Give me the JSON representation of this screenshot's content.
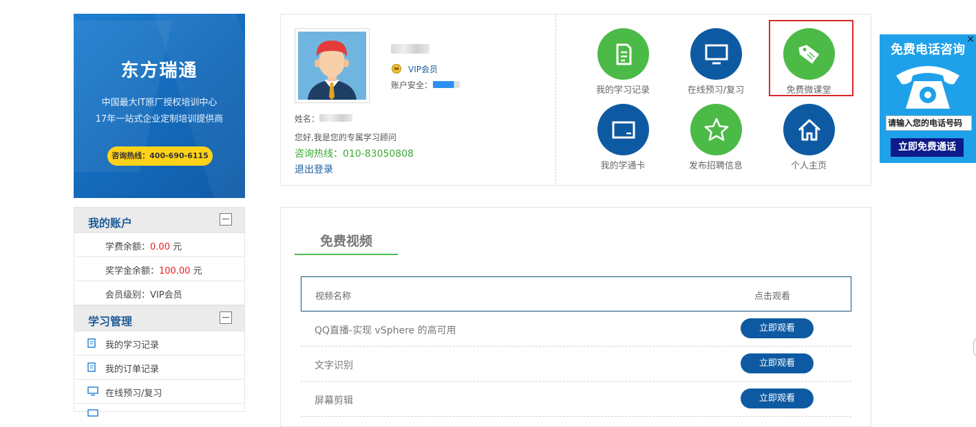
{
  "banner": {
    "title": "东方瑞通",
    "line1": "中国最大IT原厂授权培训中心",
    "line2": "17年一站式企业定制培训提供商",
    "hotline": "咨询热线：400-690-6115"
  },
  "sidebar": {
    "account": {
      "title": "我的账户",
      "rows": [
        {
          "label": "学费余额：",
          "value": "0.00",
          "unit": " 元"
        },
        {
          "label": "奖学金余额：",
          "value": "100.00",
          "unit": " 元"
        },
        {
          "label": "会员级别：VIP会员",
          "value": "",
          "unit": ""
        }
      ]
    },
    "study": {
      "title": "学习管理",
      "rows": [
        {
          "label": "我的学习记录",
          "icon": "document-icon"
        },
        {
          "label": "我的订单记录",
          "icon": "document-icon"
        },
        {
          "label": "在线预习/复习",
          "icon": "monitor-icon"
        }
      ]
    }
  },
  "profile": {
    "vip": "VIP会员",
    "security": "账户安全：",
    "name_label": "姓名：",
    "greeting": "您好,我是您的专属学习顾问",
    "hotline": "咨询热线：010-83050808",
    "logout": "退出登录"
  },
  "quick": [
    {
      "label": "我的学习记录",
      "icon": "document-icon",
      "color": "#4cba47"
    },
    {
      "label": "在线预习/复习",
      "icon": "monitor-icon",
      "color": "#0e5aa2"
    },
    {
      "label": "免费微课堂",
      "icon": "tag-icon",
      "color": "#4cba47"
    },
    {
      "label": "我的学通卡",
      "icon": "tablet-icon",
      "color": "#0e5aa2"
    },
    {
      "label": "发布招聘信息",
      "icon": "star-icon",
      "color": "#4cba47"
    },
    {
      "label": "个人主页",
      "icon": "home-icon",
      "color": "#0e5aa2"
    }
  ],
  "phone_widget": {
    "title": "免费电话咨询",
    "input_text": "请输入您的电话号码",
    "call_button": "立即免费通话",
    "close": "×"
  },
  "videos": {
    "tab": "免费视频",
    "col_name": "视频名称",
    "col_watch": "点击观看",
    "watch_label": "立即观看",
    "items": [
      "QQ直播-实现 vSphere 的高可用",
      "文字识别",
      "屏幕剪辑"
    ]
  }
}
